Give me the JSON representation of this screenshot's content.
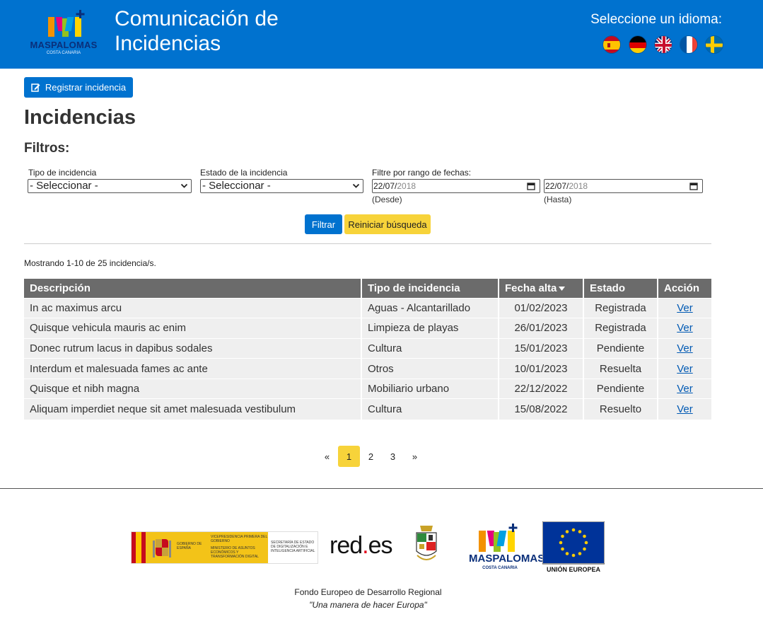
{
  "header": {
    "logo_brand": "MASPALOMAS",
    "logo_sub": "COSTA CANARIA",
    "title": "Comunicación de Incidencias",
    "language_label": "Seleccione un idioma:",
    "languages": [
      "es-flag",
      "de-flag",
      "uk-flag",
      "fr-flag",
      "se-flag"
    ]
  },
  "actions": {
    "register_label": "Registrar incidencia"
  },
  "main": {
    "title": "Incidencias",
    "filters_title": "Filtros:"
  },
  "filters": {
    "type_label": "Tipo de incidencia",
    "type_value": "- Seleccionar -",
    "state_label": "Estado de la incidencia",
    "state_value": "- Seleccionar -",
    "date_label": "Filtre por rango de fechas:",
    "from_day": "22/07/",
    "from_year": "2018",
    "from_hint": "(Desde)",
    "to_day": "22/07/",
    "to_year": "2018",
    "to_hint": "(Hasta)",
    "filter_button": "Filtrar",
    "reset_button": "Reiniciar búsqueda"
  },
  "results": {
    "showing": "Mostrando 1-10 de 25 incidencia/s."
  },
  "table": {
    "headers": [
      "Descripción",
      "Tipo de incidencia",
      "Fecha alta",
      "Estado",
      "Acción"
    ],
    "rows": [
      [
        "In ac maximus arcu",
        "Aguas - Alcantarillado",
        "01/02/2023",
        "Registrada",
        "Ver"
      ],
      [
        "Quisque vehicula mauris ac enim",
        "Limpieza de playas",
        "26/01/2023",
        "Registrada",
        "Ver"
      ],
      [
        "Donec rutrum lacus in dapibus sodales",
        "Cultura",
        "15/01/2023",
        "Pendiente",
        "Ver"
      ],
      [
        "Interdum et malesuada fames ac ante",
        "Otros",
        "10/01/2023",
        "Resuelta",
        "Ver"
      ],
      [
        "Quisque et nibh magna",
        "Mobiliario urbano",
        "22/12/2022",
        "Pendiente",
        "Ver"
      ],
      [
        "Aliquam imperdiet neque sit amet malesuada vestibulum",
        "Cultura",
        "15/08/2022",
        "Resuelto",
        "Ver"
      ]
    ]
  },
  "pagination": {
    "prev": "«",
    "pages": [
      "1",
      "2",
      "3"
    ],
    "current": "1",
    "next": "»"
  },
  "footer": {
    "gov_es": "GOBIERNO DE ESPAÑA",
    "gov_vp": "VICEPRESIDENCIA PRIMERA DEL GOBIERNO",
    "gov_min": "MINISTERIO DE ASUNTOS ECONÓMICOS Y TRANSFORMACIÓN DIGITAL",
    "gov_sec": "SECRETARÍA DE ESTADO DE DIGITALIZACIÓN E INTELIGENCIA ARTIFICIAL",
    "redes_text": "red",
    "redes_dot": ".",
    "redes_es": "es",
    "maspalomas": "MASPALOMAS",
    "costa": "COSTA CANARIA",
    "eu_label": "UNIÓN EUROPEA",
    "feder": "Fondo Europeo de Desarrollo Regional",
    "motto": "\"Una manera de hacer Europa\""
  },
  "colors": {
    "primary": "#0072cf",
    "accent": "#f7d33a",
    "table_header": "#6b6b6b",
    "row_bg": "#efefef"
  }
}
